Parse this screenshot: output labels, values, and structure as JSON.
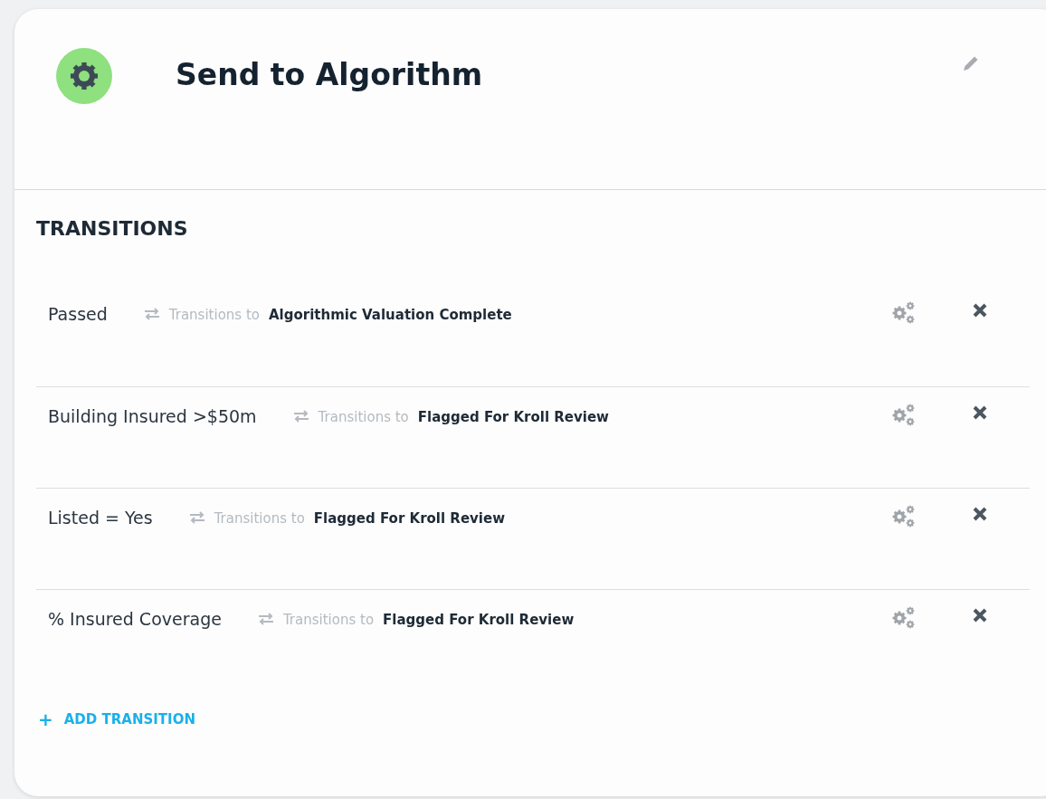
{
  "header": {
    "title": "Send to Algorithm"
  },
  "section_title": "TRANSITIONS",
  "transitions": [
    {
      "name": "Passed",
      "connector": "Transitions to",
      "target": "Algorithmic Valuation Complete"
    },
    {
      "name": "Building Insured >$50m",
      "connector": "Transitions to",
      "target": "Flagged For Kroll Review"
    },
    {
      "name": "Listed = Yes",
      "connector": "Transitions to",
      "target": "Flagged For Kroll Review"
    },
    {
      "name": "% Insured Coverage",
      "connector": "Transitions to",
      "target": "Flagged For Kroll Review"
    }
  ],
  "add_button": {
    "icon": "+",
    "label": "ADD TRANSITION"
  }
}
